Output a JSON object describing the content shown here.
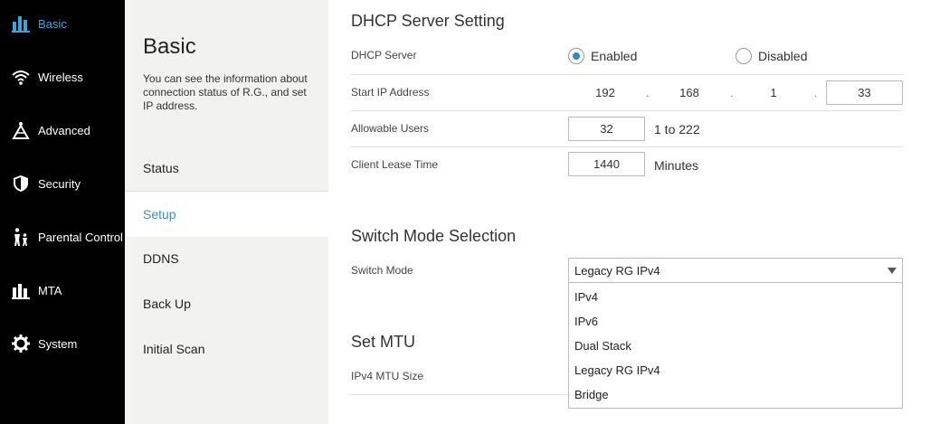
{
  "nav": {
    "items": [
      {
        "label": "Basic",
        "icon": "basic-bars-icon",
        "active": true
      },
      {
        "label": "Wireless",
        "icon": "wifi-icon"
      },
      {
        "label": "Advanced",
        "icon": "advanced-triangle-icon"
      },
      {
        "label": "Security",
        "icon": "shield-icon"
      },
      {
        "label": "Parental Control",
        "icon": "family-icon"
      },
      {
        "label": "MTA",
        "icon": "mta-bars-icon"
      },
      {
        "label": "System",
        "icon": "gear-icon"
      }
    ],
    "accent": "#3ea3d8"
  },
  "subnav": {
    "title": "Basic",
    "description": "You can see the information about connection status of R.G., and set IP address.",
    "items": [
      {
        "label": "Status"
      },
      {
        "label": "Setup",
        "active": true
      },
      {
        "label": "DDNS"
      },
      {
        "label": "Back Up"
      },
      {
        "label": "Initial Scan"
      }
    ]
  },
  "dhcp": {
    "title": "DHCP Server Setting",
    "server_label": "DHCP Server",
    "enabled_label": "Enabled",
    "disabled_label": "Disabled",
    "selected": "Enabled",
    "start_ip_label": "Start IP Address",
    "start_ip": [
      "192",
      "168",
      "1",
      "33"
    ],
    "ip_sep": ".",
    "users_label": "Allowable Users",
    "users_value": "32",
    "users_range": "1 to 222",
    "lease_label": "Client Lease Time",
    "lease_value": "1440",
    "lease_unit": "Minutes"
  },
  "switch_mode": {
    "title": "Switch Mode Selection",
    "label": "Switch Mode",
    "selected": "Legacy RG IPv4",
    "options": [
      "IPv4",
      "IPv6",
      "Dual Stack",
      "Legacy RG IPv4",
      "Bridge"
    ]
  },
  "mtu": {
    "title": "Set MTU",
    "ipv4_label": "IPv4 MTU Size"
  }
}
